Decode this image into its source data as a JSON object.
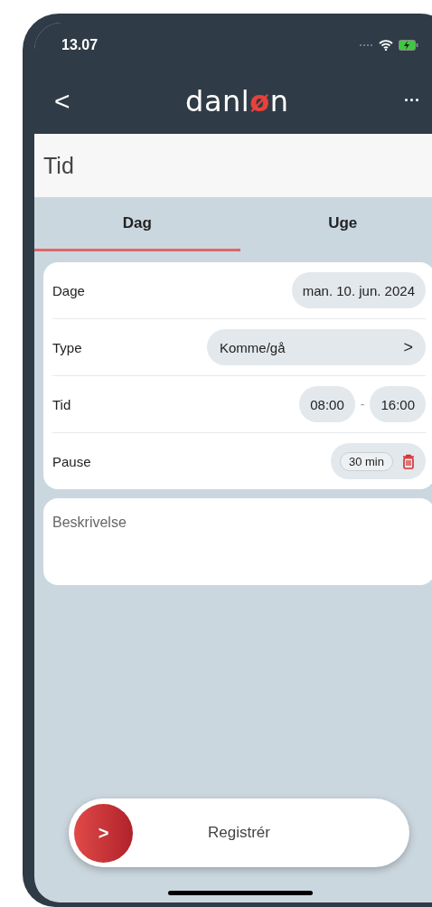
{
  "status_bar": {
    "time": "13.07"
  },
  "nav": {
    "back": "<",
    "logo": [
      {
        "text": "danl",
        "accent": false
      },
      {
        "text": "ø",
        "accent": true
      },
      {
        "text": "n",
        "accent": false
      }
    ],
    "more": "···"
  },
  "page_title": "Tid",
  "tabs": [
    {
      "label": "Dag",
      "selected": true
    },
    {
      "label": "Uge",
      "selected": false
    }
  ],
  "form_rows": [
    {
      "kind": "date",
      "label": "Dage",
      "value": "man. 10. jun. 2024"
    },
    {
      "kind": "select",
      "label": "Type",
      "value": "Komme/gå",
      "chevron": ">"
    },
    {
      "kind": "range",
      "label": "Tid",
      "start": "08:00",
      "separator": "-",
      "end": "16:00"
    },
    {
      "kind": "pause",
      "label": "Pause",
      "value": "30 min"
    }
  ],
  "description": {
    "placeholder": "Beskrivelse"
  },
  "register_button": {
    "label": "Registrér",
    "arrow": ">"
  }
}
